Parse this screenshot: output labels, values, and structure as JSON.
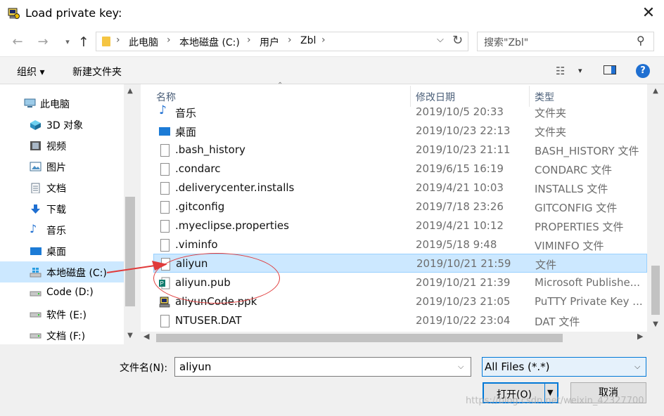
{
  "window": {
    "title": "Load private key:"
  },
  "address": {
    "crumbs": [
      "此电脑",
      "本地磁盘 (C:)",
      "用户",
      "Zbl"
    ]
  },
  "search": {
    "placeholder": "搜索\"Zbl\""
  },
  "toolbar": {
    "organize": "组织 ▾",
    "new_folder": "新建文件夹"
  },
  "nav": [
    {
      "label": "此电脑",
      "icon": "computer-icon"
    },
    {
      "label": "3D 对象",
      "icon": "3d-objects-icon"
    },
    {
      "label": "视频",
      "icon": "video-icon"
    },
    {
      "label": "图片",
      "icon": "pictures-icon"
    },
    {
      "label": "文档",
      "icon": "documents-icon"
    },
    {
      "label": "下载",
      "icon": "download-icon"
    },
    {
      "label": "音乐",
      "icon": "music-icon"
    },
    {
      "label": "桌面",
      "icon": "desktop-icon"
    },
    {
      "label": "本地磁盘 (C:)",
      "icon": "windows-drive-icon",
      "selected": true
    },
    {
      "label": "Code (D:)",
      "icon": "drive-icon"
    },
    {
      "label": "软件 (E:)",
      "icon": "drive-icon"
    },
    {
      "label": "文档 (F:)",
      "icon": "drive-icon"
    }
  ],
  "columns": {
    "name": "名称",
    "date": "修改日期",
    "type": "类型"
  },
  "files": [
    {
      "name": "音乐",
      "date": "2019/10/5 20:33",
      "type": "文件夹",
      "icon": "music-icon"
    },
    {
      "name": "桌面",
      "date": "2019/10/23 22:13",
      "type": "文件夹",
      "icon": "desktop-folder-icon"
    },
    {
      "name": ".bash_history",
      "date": "2019/10/23 21:11",
      "type": "BASH_HISTORY 文件",
      "icon": "file-icon"
    },
    {
      "name": ".condarc",
      "date": "2019/6/15 16:19",
      "type": "CONDARC 文件",
      "icon": "file-icon"
    },
    {
      "name": ".deliverycenter.installs",
      "date": "2019/4/21 10:03",
      "type": "INSTALLS 文件",
      "icon": "file-icon"
    },
    {
      "name": ".gitconfig",
      "date": "2019/7/18 23:26",
      "type": "GITCONFIG 文件",
      "icon": "file-icon"
    },
    {
      "name": ".myeclipse.properties",
      "date": "2019/4/21 10:12",
      "type": "PROPERTIES 文件",
      "icon": "file-icon"
    },
    {
      "name": ".viminfo",
      "date": "2019/5/18 9:48",
      "type": "VIMINFO 文件",
      "icon": "file-icon"
    },
    {
      "name": "aliyun",
      "date": "2019/10/21 21:59",
      "type": "文件",
      "icon": "file-icon",
      "selected": true
    },
    {
      "name": "aliyun.pub",
      "date": "2019/10/21 21:39",
      "type": "Microsoft Publishe...",
      "icon": "publisher-icon"
    },
    {
      "name": "aliyunCode.ppk",
      "date": "2019/10/23 21:05",
      "type": "PuTTY Private Key ...",
      "icon": "putty-key-icon"
    },
    {
      "name": "NTUSER.DAT",
      "date": "2019/10/22 23:04",
      "type": "DAT 文件",
      "icon": "file-icon"
    }
  ],
  "bottom": {
    "filename_label": "文件名(N):",
    "filename_value": "aliyun",
    "filetype_value": "All Files (*.*)",
    "open_label": "打开(O)",
    "cancel_label": "取消"
  },
  "watermark": "https://blog.csdn.net/weixin_42327700",
  "colors": {
    "selection": "#cce8ff",
    "accent": "#0078d7",
    "annotation": "#e03a3a"
  }
}
